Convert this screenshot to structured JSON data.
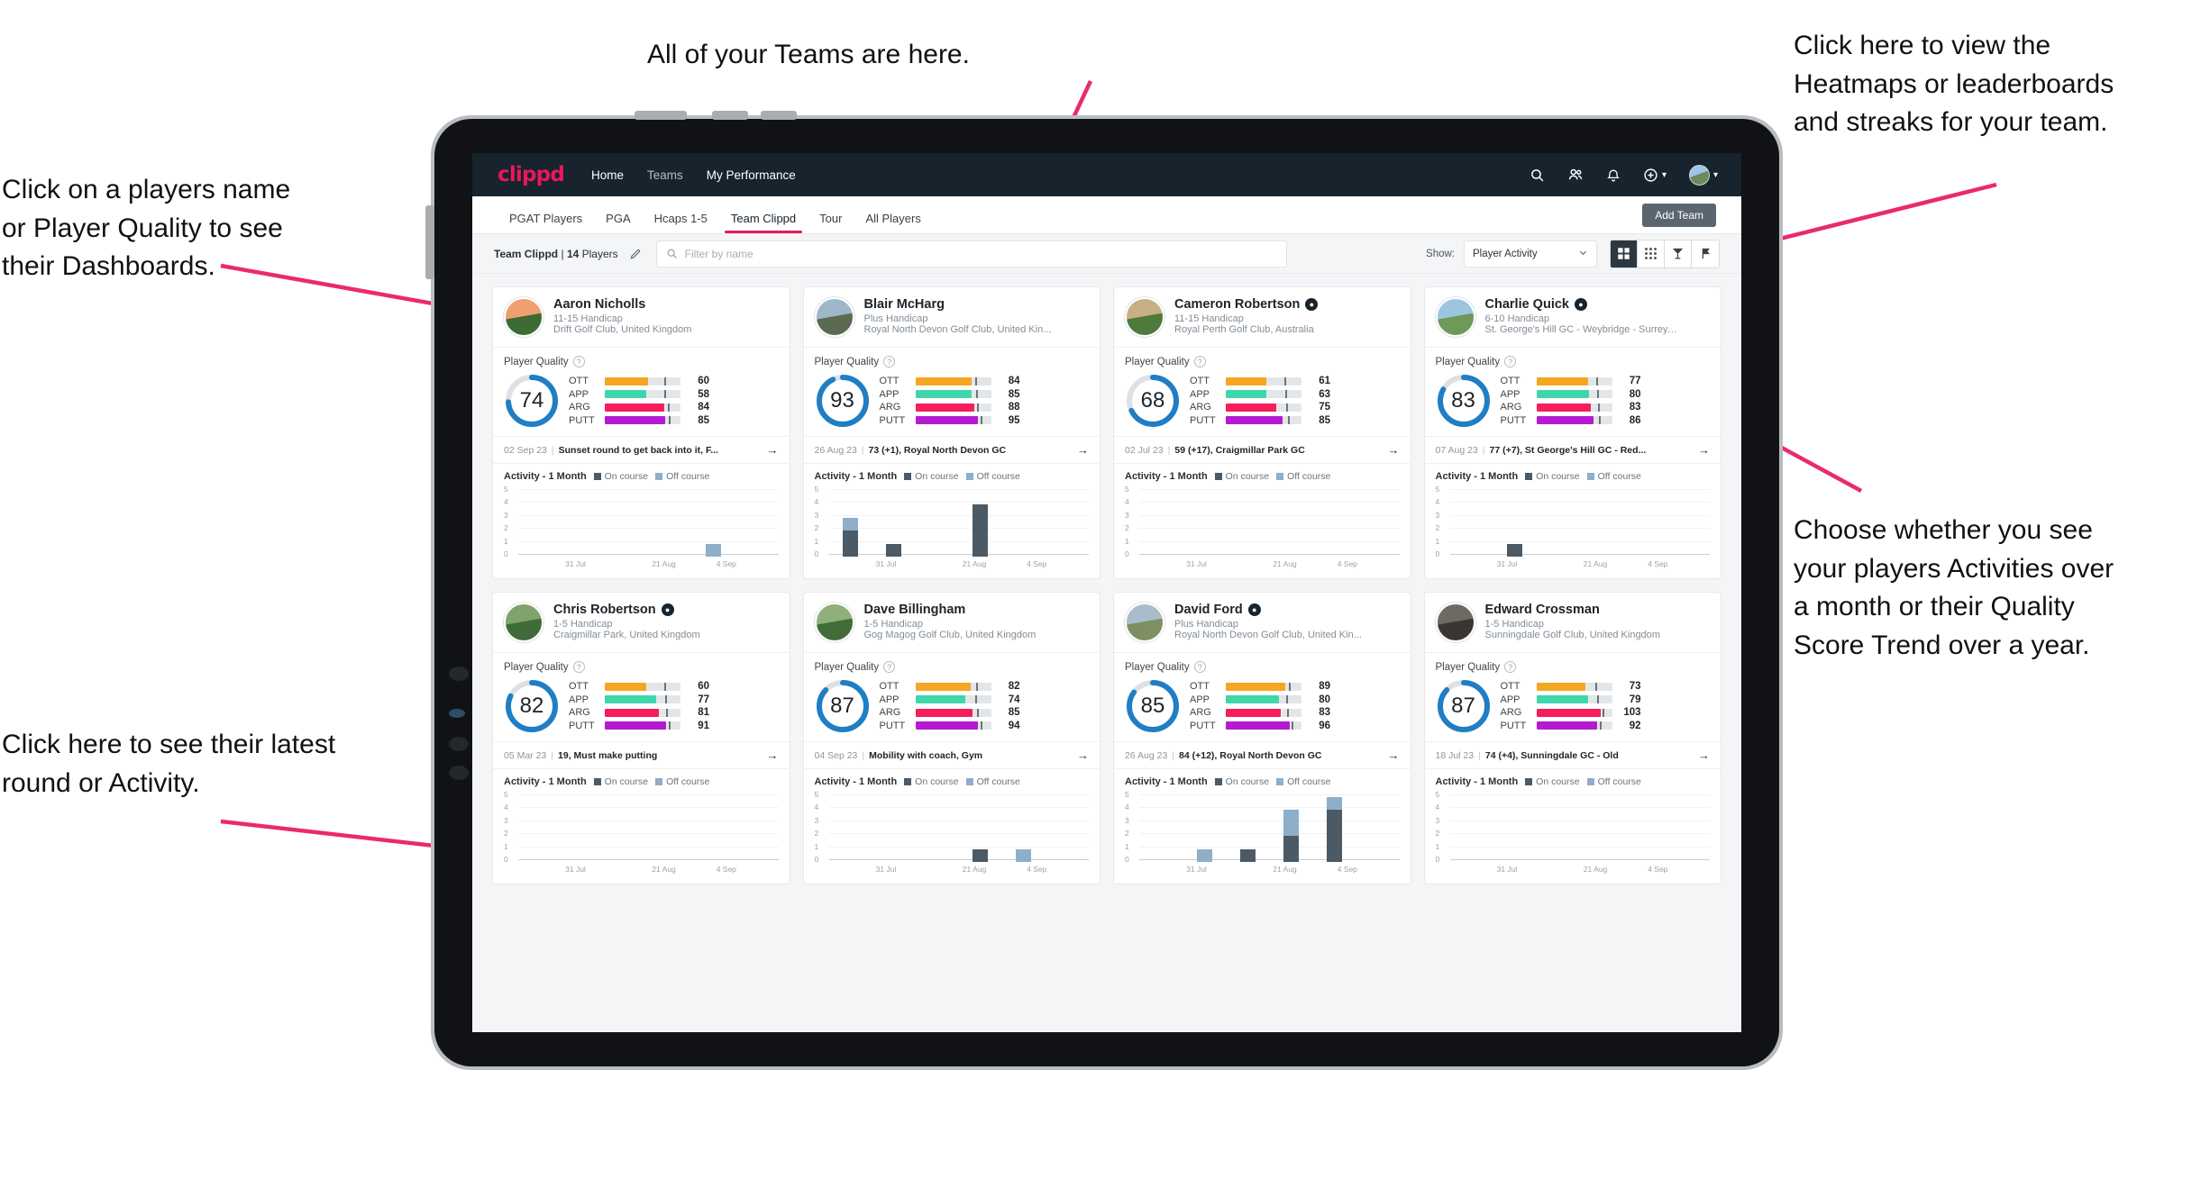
{
  "annotations": [
    {
      "id": "a-teams",
      "text": "All of your Teams are here."
    },
    {
      "id": "a-heatmaps",
      "text": "Click here to view the\nHeatmaps or leaderboards\nand streaks for your team."
    },
    {
      "id": "a-playername",
      "text": "Click on a players name\nor Player Quality to see\ntheir Dashboards."
    },
    {
      "id": "a-activity",
      "text": "Choose whether you see\nyour players Activities over\na month or their Quality\nScore Trend over a year."
    },
    {
      "id": "a-latest",
      "text": "Click here to see their latest\nround or Activity."
    }
  ],
  "nav": {
    "logo": "clippd",
    "links": [
      {
        "label": "Home",
        "active": true
      },
      {
        "label": "Teams",
        "active": false
      },
      {
        "label": "My Performance",
        "active": true
      }
    ],
    "icons": [
      "search-icon",
      "people-icon",
      "bell-icon",
      "plus-circle-icon",
      "avatar"
    ]
  },
  "tabs": [
    {
      "label": "PGAT Players",
      "active": false
    },
    {
      "label": "PGA",
      "active": false
    },
    {
      "label": "Hcaps 1-5",
      "active": false
    },
    {
      "label": "Team Clippd",
      "active": true
    },
    {
      "label": "Tour",
      "active": false
    },
    {
      "label": "All Players",
      "active": false
    }
  ],
  "add_team_label": "Add Team",
  "toolbar": {
    "team_name": "Team Clippd",
    "separator": "|",
    "player_count": "14",
    "players_word": "Players",
    "edit_icon": "pencil-icon",
    "search_placeholder": "Filter by name",
    "search_value": "",
    "show_label": "Show:",
    "select_value": "Player Activity",
    "select_options": [
      "Player Activity",
      "Quality Score Trend"
    ],
    "view_buttons": [
      {
        "icon": "card-view-icon",
        "active": true
      },
      {
        "icon": "grid-view-icon",
        "active": false
      },
      {
        "icon": "heatmap-icon",
        "active": false
      },
      {
        "icon": "leaderboard-icon",
        "active": false
      }
    ]
  },
  "card_labels": {
    "player_quality": "Player Quality",
    "activity_title": "Activity - 1 Month",
    "legend_on": "On course",
    "legend_off": "Off course",
    "metric_names": [
      "OTT",
      "APP",
      "ARG",
      "PUTT"
    ],
    "y_ticks": [
      "5",
      "4",
      "3",
      "2",
      "1",
      "0"
    ],
    "x_ticks": [
      "31 Jul",
      "21 Aug",
      "4 Sep"
    ]
  },
  "colors": {
    "brand_pink": "#e8175d",
    "nav_dark": "#17232d",
    "ring_blue": "#1f7ec4",
    "ott": "#f5a623",
    "app": "#3fd6ac",
    "arg": "#f51e5a",
    "putt": "#b51ad1",
    "on_course": "#4c5a66",
    "off_course": "#8faec9"
  },
  "players": [
    {
      "name": "Aaron Nicholls",
      "verified": false,
      "handicap": "11-15 Handicap",
      "club": "Drift Golf Club, United Kingdom",
      "quality": 74,
      "avatar": [
        "#f0a070",
        "#3d6b35"
      ],
      "metrics": [
        {
          "label": "OTT",
          "value": 60,
          "pct": 57,
          "tick": 78
        },
        {
          "label": "APP",
          "value": 58,
          "pct": 55,
          "tick": 78
        },
        {
          "label": "ARG",
          "value": 84,
          "pct": 78,
          "tick": 83
        },
        {
          "label": "PUTT",
          "value": 85,
          "pct": 80,
          "tick": 84
        }
      ],
      "round": {
        "date": "02 Sep 23",
        "text": "Sunset round to get back into it, F..."
      },
      "activity": [
        {
          "on": 0,
          "off": 0
        },
        {
          "on": 0,
          "off": 0
        },
        {
          "on": 0,
          "off": 0
        },
        {
          "on": 0,
          "off": 0
        },
        {
          "on": 0,
          "off": 1
        },
        {
          "on": 0,
          "off": 0
        }
      ]
    },
    {
      "name": "Blair McHarg",
      "verified": false,
      "handicap": "Plus Handicap",
      "club": "Royal North Devon Golf Club, United Kin...",
      "quality": 93,
      "avatar": [
        "#9db7c9",
        "#5d6a52"
      ],
      "metrics": [
        {
          "label": "OTT",
          "value": 84,
          "pct": 74,
          "tick": 79
        },
        {
          "label": "APP",
          "value": 85,
          "pct": 74,
          "tick": 80
        },
        {
          "label": "ARG",
          "value": 88,
          "pct": 78,
          "tick": 82
        },
        {
          "label": "PUTT",
          "value": 95,
          "pct": 83,
          "tick": 86
        }
      ],
      "round": {
        "date": "26 Aug 23",
        "text": "73 (+1), Royal North Devon GC"
      },
      "activity": [
        {
          "on": 2,
          "off": 1
        },
        {
          "on": 1,
          "off": 0
        },
        {
          "on": 0,
          "off": 0
        },
        {
          "on": 4,
          "off": 0
        },
        {
          "on": 0,
          "off": 0
        },
        {
          "on": 0,
          "off": 0
        }
      ]
    },
    {
      "name": "Cameron Robertson",
      "verified": true,
      "handicap": "11-15 Handicap",
      "club": "Royal Perth Golf Club, Australia",
      "quality": 68,
      "avatar": [
        "#c7b183",
        "#4e7a3c"
      ],
      "metrics": [
        {
          "label": "OTT",
          "value": 61,
          "pct": 53,
          "tick": 77
        },
        {
          "label": "APP",
          "value": 63,
          "pct": 54,
          "tick": 78
        },
        {
          "label": "ARG",
          "value": 75,
          "pct": 67,
          "tick": 80
        },
        {
          "label": "PUTT",
          "value": 85,
          "pct": 75,
          "tick": 82
        }
      ],
      "round": {
        "date": "02 Jul 23",
        "text": "59 (+17), Craigmillar Park GC"
      },
      "activity": [
        {
          "on": 0,
          "off": 0
        },
        {
          "on": 0,
          "off": 0
        },
        {
          "on": 0,
          "off": 0
        },
        {
          "on": 0,
          "off": 0
        },
        {
          "on": 0,
          "off": 0
        },
        {
          "on": 0,
          "off": 0
        }
      ]
    },
    {
      "name": "Charlie Quick",
      "verified": true,
      "handicap": "6-10 Handicap",
      "club": "St. George's Hill GC - Weybridge - Surrey, ...",
      "quality": 83,
      "avatar": [
        "#9cc6e0",
        "#6e9a58"
      ],
      "metrics": [
        {
          "label": "OTT",
          "value": 77,
          "pct": 68,
          "tick": 79
        },
        {
          "label": "APP",
          "value": 80,
          "pct": 70,
          "tick": 80
        },
        {
          "label": "ARG",
          "value": 83,
          "pct": 72,
          "tick": 81
        },
        {
          "label": "PUTT",
          "value": 86,
          "pct": 76,
          "tick": 83
        }
      ],
      "round": {
        "date": "07 Aug 23",
        "text": "77 (+7), St George's Hill GC - Red..."
      },
      "activity": [
        {
          "on": 0,
          "off": 0
        },
        {
          "on": 1,
          "off": 0
        },
        {
          "on": 0,
          "off": 0
        },
        {
          "on": 0,
          "off": 0
        },
        {
          "on": 0,
          "off": 0
        },
        {
          "on": 0,
          "off": 0
        }
      ]
    },
    {
      "name": "Chris Robertson",
      "verified": true,
      "handicap": "1-5 Handicap",
      "club": "Craigmillar Park, United Kingdom",
      "quality": 82,
      "avatar": [
        "#7fa36a",
        "#3f6b3a"
      ],
      "metrics": [
        {
          "label": "OTT",
          "value": 60,
          "pct": 55,
          "tick": 78
        },
        {
          "label": "APP",
          "value": 77,
          "pct": 68,
          "tick": 80
        },
        {
          "label": "ARG",
          "value": 81,
          "pct": 72,
          "tick": 81
        },
        {
          "label": "PUTT",
          "value": 91,
          "pct": 81,
          "tick": 85
        }
      ],
      "round": {
        "date": "05 Mar 23",
        "text": "19, Must make putting"
      },
      "activity": [
        {
          "on": 0,
          "off": 0
        },
        {
          "on": 0,
          "off": 0
        },
        {
          "on": 0,
          "off": 0
        },
        {
          "on": 0,
          "off": 0
        },
        {
          "on": 0,
          "off": 0
        },
        {
          "on": 0,
          "off": 0
        }
      ]
    },
    {
      "name": "Dave Billingham",
      "verified": false,
      "handicap": "1-5 Handicap",
      "club": "Gog Magog Golf Club, United Kingdom",
      "quality": 87,
      "avatar": [
        "#8fb07a",
        "#426c38"
      ],
      "metrics": [
        {
          "label": "OTT",
          "value": 82,
          "pct": 73,
          "tick": 80
        },
        {
          "label": "APP",
          "value": 74,
          "pct": 66,
          "tick": 79
        },
        {
          "label": "ARG",
          "value": 85,
          "pct": 75,
          "tick": 82
        },
        {
          "label": "PUTT",
          "value": 94,
          "pct": 83,
          "tick": 86
        }
      ],
      "round": {
        "date": "04 Sep 23",
        "text": "Mobility with coach, Gym"
      },
      "activity": [
        {
          "on": 0,
          "off": 0
        },
        {
          "on": 0,
          "off": 0
        },
        {
          "on": 0,
          "off": 0
        },
        {
          "on": 1,
          "off": 0
        },
        {
          "on": 0,
          "off": 1
        },
        {
          "on": 0,
          "off": 0
        }
      ]
    },
    {
      "name": "David Ford",
      "verified": true,
      "handicap": "Plus Handicap",
      "club": "Royal North Devon Golf Club, United Kin...",
      "quality": 85,
      "avatar": [
        "#a8bdc9",
        "#7d8f63"
      ],
      "metrics": [
        {
          "label": "OTT",
          "value": 89,
          "pct": 79,
          "tick": 83
        },
        {
          "label": "APP",
          "value": 80,
          "pct": 70,
          "tick": 80
        },
        {
          "label": "ARG",
          "value": 83,
          "pct": 73,
          "tick": 81
        },
        {
          "label": "PUTT",
          "value": 96,
          "pct": 84,
          "tick": 87
        }
      ],
      "round": {
        "date": "26 Aug 23",
        "text": "84 (+12), Royal North Devon GC"
      },
      "activity": [
        {
          "on": 0,
          "off": 0
        },
        {
          "on": 0,
          "off": 1
        },
        {
          "on": 1,
          "off": 0
        },
        {
          "on": 2,
          "off": 2
        },
        {
          "on": 4,
          "off": 1
        },
        {
          "on": 0,
          "off": 0
        }
      ]
    },
    {
      "name": "Edward Crossman",
      "verified": false,
      "handicap": "1-5 Handicap",
      "club": "Sunningdale Golf Club, United Kingdom",
      "quality": 87,
      "avatar": [
        "#6e6a63",
        "#3a3733"
      ],
      "metrics": [
        {
          "label": "OTT",
          "value": 73,
          "pct": 65,
          "tick": 78
        },
        {
          "label": "APP",
          "value": 79,
          "pct": 69,
          "tick": 80
        },
        {
          "label": "ARG",
          "value": 103,
          "pct": 85,
          "tick": 88
        },
        {
          "label": "PUTT",
          "value": 92,
          "pct": 80,
          "tick": 84
        }
      ],
      "round": {
        "date": "18 Jul 23",
        "text": "74 (+4), Sunningdale GC - Old"
      },
      "activity": [
        {
          "on": 0,
          "off": 0
        },
        {
          "on": 0,
          "off": 0
        },
        {
          "on": 0,
          "off": 0
        },
        {
          "on": 0,
          "off": 0
        },
        {
          "on": 0,
          "off": 0
        },
        {
          "on": 0,
          "off": 0
        }
      ]
    }
  ]
}
